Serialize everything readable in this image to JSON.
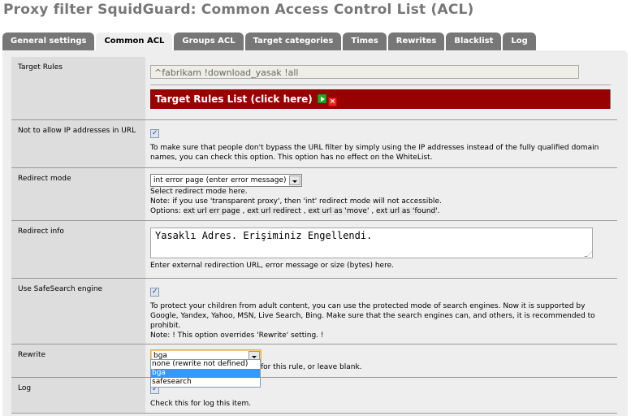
{
  "page": {
    "title": "Proxy filter SquidGuard: Common Access Control List (ACL)"
  },
  "tabs": [
    {
      "label": "General settings",
      "active": false
    },
    {
      "label": "Common ACL",
      "active": true
    },
    {
      "label": "Groups ACL",
      "active": false
    },
    {
      "label": "Target categories",
      "active": false
    },
    {
      "label": "Times",
      "active": false
    },
    {
      "label": "Rewrites",
      "active": false
    },
    {
      "label": "Blacklist",
      "active": false
    },
    {
      "label": "Log",
      "active": false
    }
  ],
  "form": {
    "target_rules": {
      "label": "Target Rules",
      "value": "^fabrikam !download_yasak !all",
      "list_button": "Target Rules List (click here)",
      "show_icon": "green-play-icon",
      "hide_icon": "red-x-icon"
    },
    "no_ip": {
      "label": "Not to allow IP addresses in URL",
      "checked": true,
      "help": "To make sure that people don't bypass the URL filter by simply using the IP addresses instead of the fully qualified domain names, you can check this option. This option has no effect on the WhiteList."
    },
    "redirect_mode": {
      "label": "Redirect mode",
      "selected": "int error page (enter error message)",
      "help1": "Select redirect mode here.",
      "help2": "Note: if you use 'transparent proxy', then 'int' redirect mode will not accessible.",
      "help3_prefix": "Options: ",
      "options_shown": [
        "ext url err page",
        "ext url redirect",
        "ext url as 'move'",
        "ext url as 'found'"
      ],
      "sep": " , ",
      "end": "."
    },
    "redirect_info": {
      "label": "Redirect info",
      "value": "Yasaklı Adres. Erişiminiz Engellendi.",
      "help": "Enter external redirection URL, error message or size (bytes) here."
    },
    "safesearch": {
      "label": "Use SafeSearch engine",
      "checked": true,
      "help": "To protect your children from adult content, you can use the protected mode of search engines. Now it is supported by Google, Yandex, Yahoo, MSN, Live Search, Bing. Make sure that the search engines can, and others, it is recommended to prohibit.",
      "note": "Note: ! This option overrides 'Rewrite' setting. !"
    },
    "rewrite": {
      "label": "Rewrite",
      "selected": "bga",
      "help_visible": "for this rule, or leave blank.",
      "dropdown_open": true,
      "options": [
        "none (rewrite not defined)",
        "bga",
        "safesearch"
      ],
      "highlighted": "bga"
    },
    "log": {
      "label": "Log",
      "checked": true,
      "help": "Check this for log this item."
    }
  }
}
